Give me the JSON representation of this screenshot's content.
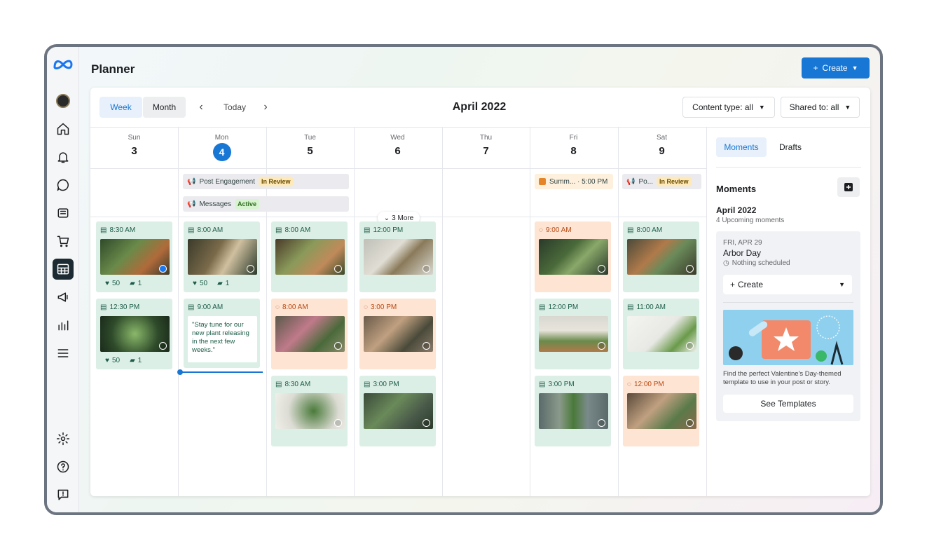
{
  "app": {
    "title": "Planner",
    "create_label": "Create"
  },
  "toolbar": {
    "week": "Week",
    "month": "Month",
    "today": "Today",
    "prev_glyph": "‹",
    "next_glyph": "›",
    "title": "April 2022",
    "content_filter": "Content type: all",
    "shared_filter": "Shared to: all"
  },
  "days": [
    {
      "name": "Sun",
      "date": "3"
    },
    {
      "name": "Mon",
      "date": "4",
      "today": true
    },
    {
      "name": "Tue",
      "date": "5"
    },
    {
      "name": "Wed",
      "date": "6"
    },
    {
      "name": "Thu",
      "date": "7"
    },
    {
      "name": "Fri",
      "date": "8"
    },
    {
      "name": "Sat",
      "date": "9"
    }
  ],
  "banners": {
    "engagement": {
      "label": "Post Engagement",
      "status": "In Review"
    },
    "messages": {
      "label": "Messages",
      "status": "Active"
    },
    "summ": {
      "label": "Summ... · 5:00 PM"
    },
    "po": {
      "label": "Po...",
      "status": "In Review"
    }
  },
  "more_label": "3 More",
  "posts": {
    "sun1": {
      "time": "8:30 AM",
      "likes": "50",
      "comments": "1"
    },
    "sun2": {
      "time": "12:30 PM",
      "likes": "50",
      "comments": "1"
    },
    "mon1": {
      "time": "8:00 AM",
      "likes": "50",
      "comments": "1"
    },
    "mon2": {
      "time": "9:00 AM",
      "quote": "\"Stay tune for our new plant releasing in the next few weeks.\""
    },
    "tue1": {
      "time": "8:00 AM"
    },
    "tue2": {
      "time": "8:00 AM"
    },
    "tue3": {
      "time": "8:30 AM"
    },
    "wed1": {
      "time": "12:00 PM"
    },
    "wed2": {
      "time": "3:00 PM"
    },
    "wed3": {
      "time": "3:00 PM"
    },
    "fri1": {
      "time": "9:00 AM"
    },
    "fri2": {
      "time": "12:00 PM"
    },
    "fri3": {
      "time": "3:00 PM"
    },
    "sat1": {
      "time": "8:00 AM"
    },
    "sat2": {
      "time": "11:00 AM"
    },
    "sat3": {
      "time": "12:00 PM"
    }
  },
  "moments": {
    "tab_moments": "Moments",
    "tab_drafts": "Drafts",
    "heading": "Moments",
    "month": "April 2022",
    "count": "4 Upcoming moments",
    "date": "FRI, APR 29",
    "name": "Arbor Day",
    "status": "Nothing scheduled",
    "create": "Create",
    "desc": "Find the perfect Valentine's Day-themed template to use in your post or story.",
    "see": "See Templates"
  },
  "colors": {
    "accent": "#1877d4",
    "published": "#dcefe7",
    "scheduled": "#fde4d3"
  }
}
